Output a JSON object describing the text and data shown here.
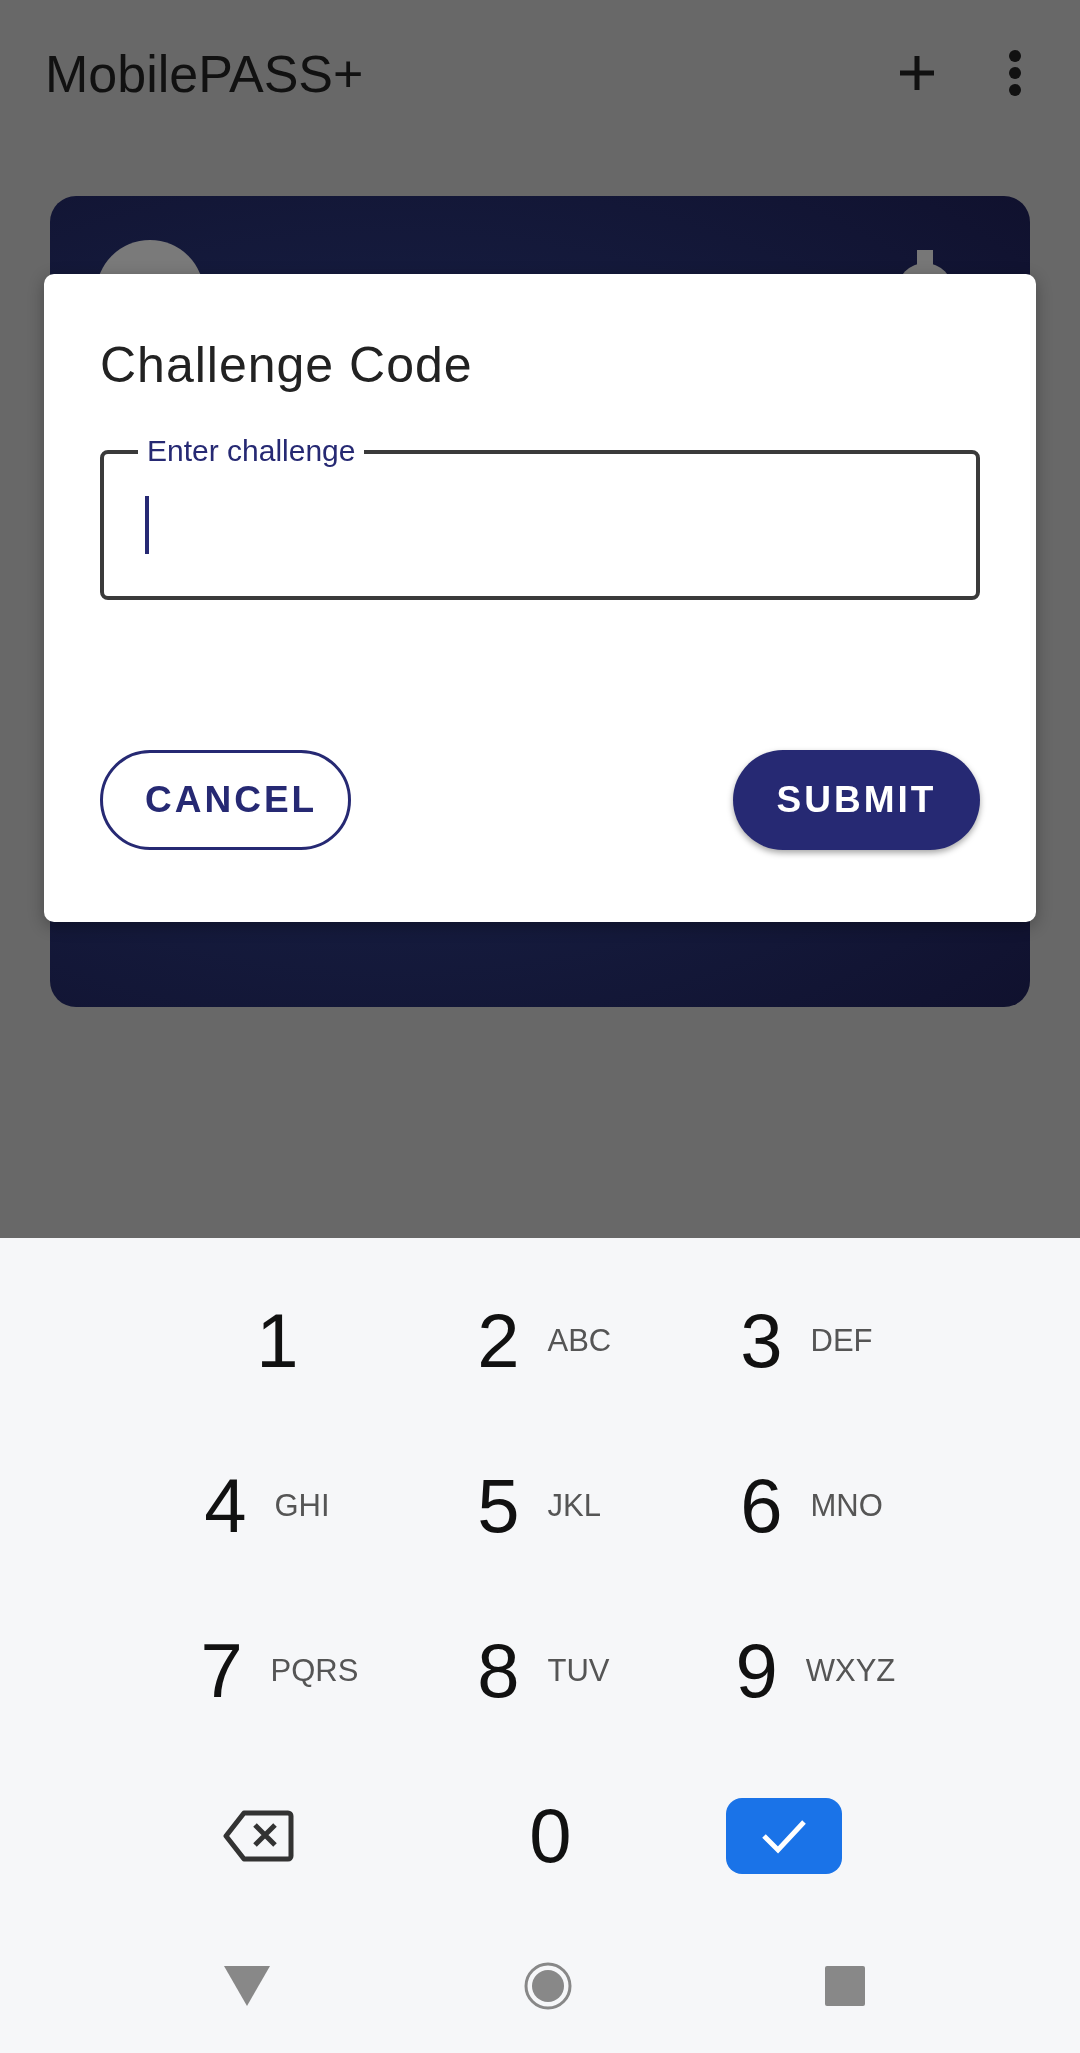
{
  "app_bar": {
    "title": "MobilePASS+"
  },
  "dialog": {
    "title": "Challenge Code",
    "field": {
      "label": "Enter challenge",
      "focused": true
    },
    "buttons": [
      {
        "kind": "outlined",
        "label": "CANCEL"
      },
      {
        "kind": "filled",
        "label": "SUBMIT"
      }
    ]
  },
  "keypad": {
    "keys": [
      {
        "kind": "digit",
        "digit": "1"
      },
      {
        "kind": "digit",
        "digit": "2",
        "letters": "ABC"
      },
      {
        "kind": "digit",
        "digit": "3",
        "letters": "DEF"
      },
      {
        "kind": "digit",
        "digit": "4",
        "letters": "GHI"
      },
      {
        "kind": "digit",
        "digit": "5",
        "letters": "JKL"
      },
      {
        "kind": "digit",
        "digit": "6",
        "letters": "MNO"
      },
      {
        "kind": "digit",
        "digit": "7",
        "letters": "PQRS"
      },
      {
        "kind": "digit",
        "digit": "8",
        "letters": "TUV"
      },
      {
        "kind": "digit",
        "digit": "9",
        "letters": "WXYZ"
      },
      {
        "kind": "backspace"
      },
      {
        "kind": "digit",
        "digit": "0"
      },
      {
        "kind": "enter"
      }
    ]
  }
}
